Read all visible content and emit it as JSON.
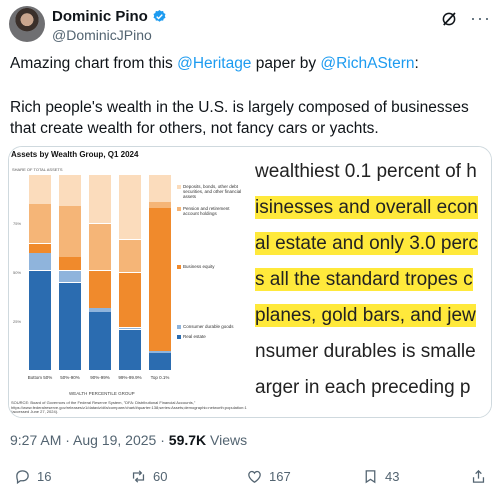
{
  "author": {
    "name": "Dominic Pino",
    "handle": "@DominicJPino"
  },
  "tweet": {
    "line1_prefix": "Amazing chart from this ",
    "mention1": "@Heritage",
    "line1_mid": " paper by ",
    "mention2": "@RichAStern",
    "line1_suffix": ":",
    "line2": "Rich people's wealth in the U.S. is largely composed of businesses that create wealth for others, not fancy cars or yachts."
  },
  "image": {
    "chart_title": "Assets by Wealth Group, Q1 2024",
    "ylabel": "SHARE OF TOTAL ASSETS",
    "xlabel": "WEALTH PERCENTILE GROUP",
    "source": "SOURCE: Board of Governors of the Federal Reserve System, \"DFA: Distributional Financial Accounts,\" https://www.federalreserve.gov/releases/z1/dataviz/dfa/compare/chart/#quarter:138;series:Assets;demographic:networth;population:1,3,5,7,9;units:shares;range:2009.1,2024.1 (accessed June 27, 2024).",
    "text_lines": [
      {
        "text": "wealthiest 0.1 percent of h",
        "highlight": false
      },
      {
        "text": "isinesses and overall econ",
        "highlight": true
      },
      {
        "text": "al estate and only 3.0 perc",
        "highlight": true
      },
      {
        "text": "s all the standard tropes c",
        "highlight": true
      },
      {
        "text": "planes, gold bars, and jew",
        "highlight": true
      },
      {
        "text": "nsumer durables is smalle",
        "highlight": false
      },
      {
        "text": "arger in each preceding p",
        "highlight": false
      }
    ]
  },
  "chart_data": {
    "type": "bar",
    "stacked": true,
    "title": "Assets by Wealth Group, Q1 2024",
    "ylabel": "SHARE OF TOTAL ASSETS",
    "xlabel": "WEALTH PERCENTILE GROUP",
    "yticks": [
      "25%",
      "50%",
      "75%"
    ],
    "ylim": [
      0,
      100
    ],
    "categories": [
      "Bottom 50%",
      "50%-90%",
      "90%-99%",
      "99%-99.9%",
      "Top 0.1%"
    ],
    "series": [
      {
        "name": "Real estate",
        "color": "#2b6cb0",
        "values": [
          51,
          45,
          30,
          21,
          9
        ]
      },
      {
        "name": "Consumer durable goods",
        "color": "#8fb4dc",
        "values": [
          9,
          6,
          2,
          1,
          1
        ]
      },
      {
        "name": "Business equity",
        "color": "#f08a2c",
        "values": [
          5,
          7,
          19,
          28,
          73
        ]
      },
      {
        "name": "Pension and retirement account holdings",
        "color": "#f5b577",
        "values": [
          20,
          26,
          24,
          17,
          3
        ]
      },
      {
        "name": "Deposits, bonds, other debt securities, and other financial assets",
        "color": "#fbdcbc",
        "values": [
          15,
          16,
          25,
          33,
          14
        ]
      }
    ]
  },
  "footer": {
    "time": "9:27 AM · Aug 19, 2025 · ",
    "views_count": "59.7K",
    "views_label": " Views"
  },
  "actions": {
    "replies": "16",
    "reposts": "60",
    "likes": "167",
    "bookmarks": "43"
  },
  "colors": {
    "link": "#1d9bf0",
    "verified": "#1d9bf0",
    "highlight": "#ffe93b"
  }
}
